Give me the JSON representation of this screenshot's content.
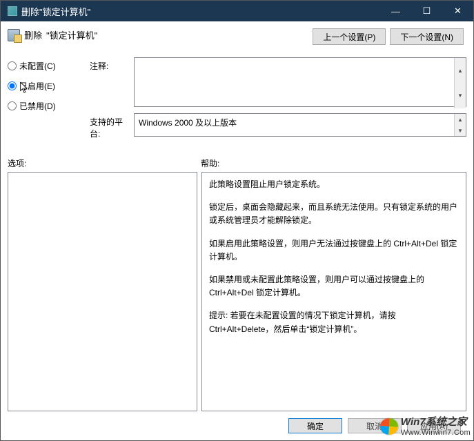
{
  "titlebar": {
    "title": "删除\"锁定计算机\"",
    "minimize_icon": "minimize-icon",
    "maximize_icon": "maximize-icon",
    "close_icon": "close-icon"
  },
  "policy": {
    "action_label": "删除",
    "name": "\"锁定计算机\""
  },
  "nav": {
    "prev_label": "上一个设置(P)",
    "next_label": "下一个设置(N)"
  },
  "radios": {
    "not_configured": "未配置(C)",
    "enabled": "已启用(E)",
    "disabled": "已禁用(D)",
    "selected": "enabled"
  },
  "labels": {
    "comment": "注释:",
    "platform": "支持的平台:",
    "options": "选项:",
    "help": "帮助:"
  },
  "fields": {
    "comment_value": "",
    "platform_value": "Windows 2000 及以上版本"
  },
  "help_paragraphs": [
    "此策略设置阻止用户锁定系统。",
    "锁定后，桌面会隐藏起来，而且系统无法使用。只有锁定系统的用户或系统管理员才能解除锁定。",
    "如果启用此策略设置，则用户无法通过按键盘上的 Ctrl+Alt+Del 锁定计算机。",
    "如果禁用或未配置此策略设置，则用户可以通过按键盘上的 Ctrl+Alt+Del 锁定计算机。",
    "提示: 若要在未配置设置的情况下锁定计算机，请按 Ctrl+Alt+Delete，然后单击“锁定计算机”。"
  ],
  "buttons": {
    "ok": "确定",
    "cancel": "取消",
    "apply": "应用(A)"
  },
  "watermark": {
    "line1": "Win7系统之家",
    "line2": "Www.Winwin7.Com"
  }
}
